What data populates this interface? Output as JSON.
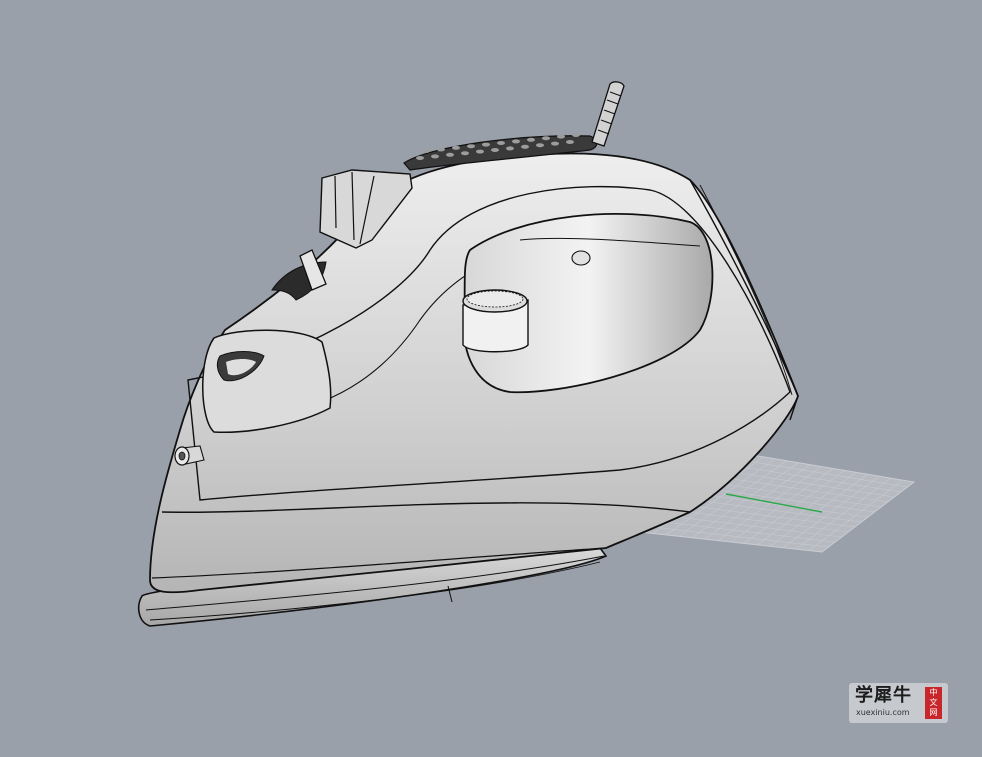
{
  "viewport": {
    "background": "#9aa0aa",
    "object": "steam-iron-render"
  },
  "colors": {
    "body_light": "#e9e9e9",
    "body_mid": "#c6c6c6",
    "body_dark": "#8f8f8f",
    "outline": "#111111",
    "grid": "#c4c6cc",
    "axis_green": "#2da84a"
  },
  "watermark": {
    "main_text": "学犀牛",
    "sub_text": "xuexiniu.com",
    "seal_text": "中文网"
  }
}
